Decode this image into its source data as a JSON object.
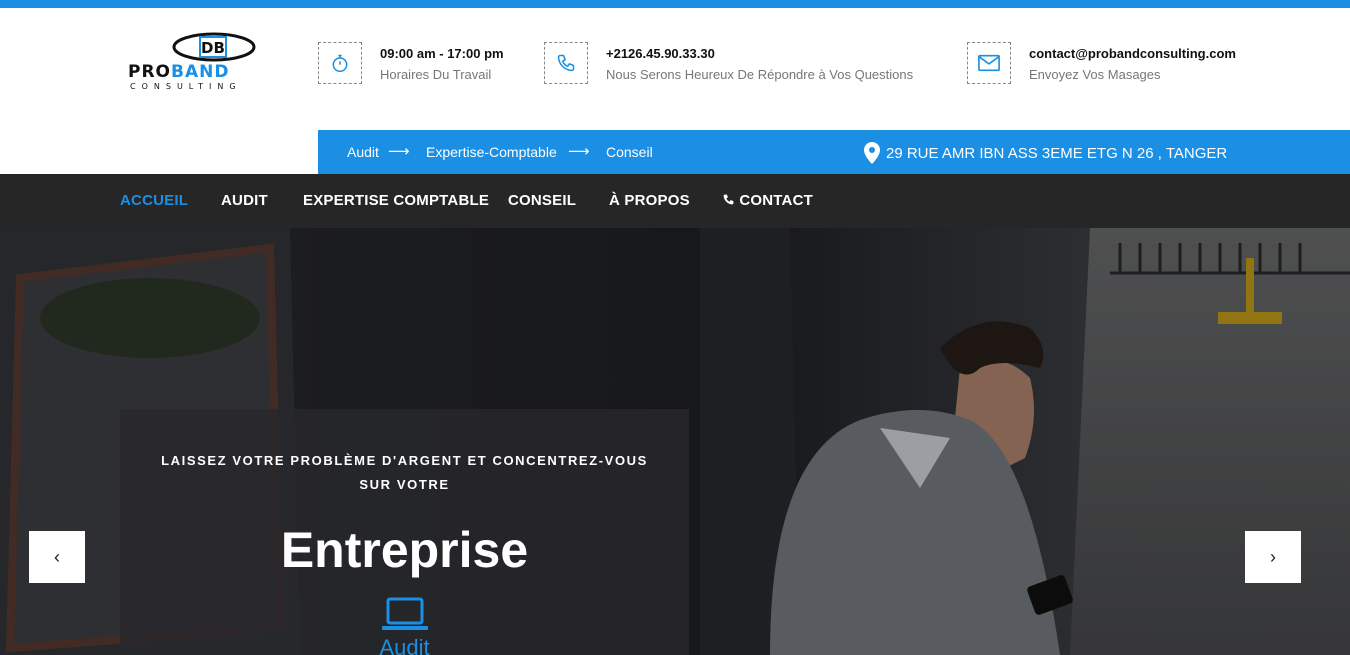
{
  "brand": {
    "logo_initials": "DB",
    "name_part1": "PRO",
    "name_part2": "BAND",
    "tagline": "CONSULTING"
  },
  "header_info": [
    {
      "icon": "stopwatch-icon",
      "title": "09:00 am - 17:00 pm",
      "subtitle": "Horaires Du Travail"
    },
    {
      "icon": "phone-icon",
      "title": "+2126.45.90.33.30",
      "subtitle": "Nous Serons Heureux De Répondre à Vos Questions"
    },
    {
      "icon": "envelope-icon",
      "title": "contact@probandconsulting.com",
      "subtitle": "Envoyez Vos Masages"
    }
  ],
  "service_bar": {
    "links": [
      "Audit",
      "Expertise-Comptable",
      "Conseil"
    ],
    "arrow": "⟶",
    "address": "29 RUE AMR IBN ASS 3EME ETG N 26 , TANGER"
  },
  "nav": {
    "items": [
      "ACCUEIL",
      "AUDIT",
      "EXPERTISE COMPTABLE",
      "CONSEIL",
      "À PROPOS",
      "CONTACT"
    ],
    "active_index": 0
  },
  "hero": {
    "tagline": "LAISSEZ VOTRE PROBLÈME D'ARGENT ET CONCENTREZ-VOUS SUR VOTRE",
    "headline": "Entreprise",
    "service_label": "Audit",
    "prev_symbol": "‹",
    "next_symbol": "›"
  },
  "colors": {
    "accent": "#1a8fe3",
    "nav_bg": "#262626",
    "panel_bg": "rgba(40,40,44,0.82)"
  }
}
